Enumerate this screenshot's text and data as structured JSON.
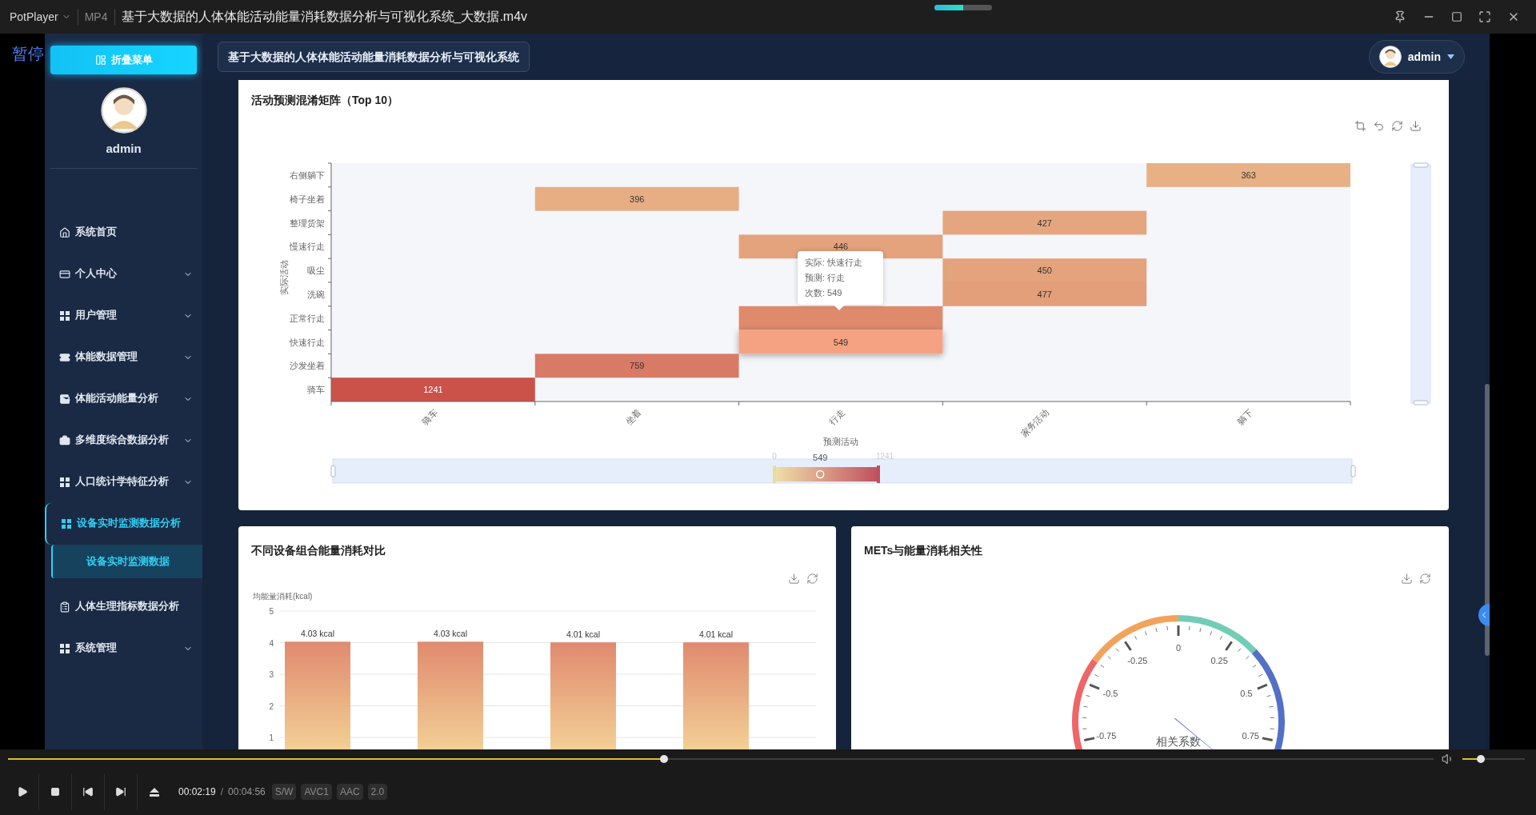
{
  "player": {
    "app_name": "PotPlayer",
    "format": "MP4",
    "file_title": "基于大数据的人体体能活动能量消耗数据分析与可视化系统_大数据.m4v",
    "osd": "暂停",
    "top_indicator": {
      "level": 0.5
    },
    "seek": {
      "level": 0.46
    },
    "volume": {
      "level": 0.3
    },
    "time_current": "00:02:19",
    "time_separator": "/",
    "time_total": "00:04:56",
    "tags": [
      "S/W",
      "AVC1",
      "AAC",
      "2.0"
    ]
  },
  "sidebar": {
    "collapse_button": "折叠菜单",
    "username": "admin",
    "items": [
      {
        "label": "系统首页",
        "kind": "link",
        "selected": false
      },
      {
        "label": "个人中心",
        "kind": "submenu",
        "selected": false,
        "expanded": false
      },
      {
        "label": "用户管理",
        "kind": "submenu",
        "selected": false,
        "expanded": false
      },
      {
        "label": "体能数据管理",
        "kind": "submenu",
        "selected": false,
        "expanded": false
      },
      {
        "label": "体能活动能量分析",
        "kind": "submenu",
        "selected": false,
        "expanded": false
      },
      {
        "label": "多维度综合数据分析",
        "kind": "submenu",
        "selected": false,
        "expanded": false
      },
      {
        "label": "人口统计学特征分析",
        "kind": "submenu",
        "selected": false,
        "expanded": false
      },
      {
        "label": "设备实时监测数据分析",
        "kind": "submenu",
        "selected": true,
        "expanded": true,
        "children": [
          {
            "label": "设备实时监测数据",
            "selected": true
          }
        ]
      },
      {
        "label": "人体生理指标数据分析",
        "kind": "link",
        "selected": false
      },
      {
        "label": "系统管理",
        "kind": "submenu",
        "selected": false,
        "expanded": false
      }
    ]
  },
  "header": {
    "title": "基于大数据的人体体能活动能量消耗数据分析与可视化系统",
    "user": "admin"
  },
  "confusion_matrix": {
    "title": "活动预测混淆矩阵（Top 10）",
    "x_axis_name": "预测活动",
    "y_axis_name": "实际活动",
    "x_categories": [
      "骑车",
      "坐着",
      "行走",
      "家务活动",
      "躺下"
    ],
    "rows": [
      {
        "label": "右侧躺下",
        "cells": [
          null,
          null,
          null,
          null,
          {
            "label": "363",
            "color": "#e8b085",
            "highlighted": false
          }
        ]
      },
      {
        "label": "椅子坐着",
        "cells": [
          null,
          {
            "label": "396",
            "color": "#e7ad83",
            "highlighted": false
          },
          null,
          null,
          null
        ]
      },
      {
        "label": "整理货架",
        "cells": [
          null,
          null,
          null,
          {
            "label": "427",
            "color": "#e5a67f",
            "highlighted": false
          },
          null
        ]
      },
      {
        "label": "慢速行走",
        "cells": [
          null,
          null,
          {
            "label": "446",
            "color": "#e4a37d",
            "highlighted": false
          },
          null,
          null
        ]
      },
      {
        "label": "吸尘",
        "cells": [
          null,
          null,
          null,
          {
            "label": "450",
            "color": "#e4a27d",
            "highlighted": false
          },
          null
        ]
      },
      {
        "label": "洗碗",
        "cells": [
          null,
          null,
          null,
          {
            "label": "477",
            "color": "#e39e7a",
            "highlighted": false
          },
          null
        ]
      },
      {
        "label": "正常行走",
        "cells": [
          null,
          null,
          {
            "color": "#df8a6c",
            "highlighted": false
          },
          null,
          null
        ]
      },
      {
        "label": "快速行走",
        "cells": [
          null,
          null,
          {
            "label": "549",
            "color": "#f5a282",
            "highlighted": true
          },
          null,
          null
        ]
      },
      {
        "label": "沙发坐着",
        "cells": [
          null,
          {
            "label": "759",
            "color": "#d97a66",
            "highlighted": false
          },
          null,
          null,
          null
        ]
      },
      {
        "label": "骑车",
        "cells": [
          {
            "label": "1241",
            "color": "#cb5249",
            "highlighted": false
          },
          null,
          null,
          null,
          null
        ]
      }
    ],
    "x_zoom": {
      "level": 1
    },
    "y_zoom": {
      "level": 1
    },
    "tooltip": [
      "实际: 快速行走",
      "预测: 行走",
      "次数: 549"
    ],
    "visual_map": {
      "min_label": "0",
      "max_label": "1241",
      "value_label": "549",
      "level": 0.44
    }
  },
  "device_energy": {
    "title": "不同设备组合能量消耗对比",
    "chart_data": {
      "type": "bar",
      "ylabel": "均能量消耗(kcal)",
      "values": [
        4.03,
        4.03,
        4.01,
        4.01
      ],
      "yticks": [
        1,
        2,
        3,
        4,
        5
      ],
      "ylim": [
        0,
        5
      ],
      "grid": true,
      "data_labels": true,
      "value_labels": [
        "4.03 kcal",
        "4.03 kcal",
        "4.01 kcal",
        "4.01 kcal"
      ]
    }
  },
  "mets_correlation": {
    "title": "METs与能量消耗相关性",
    "gauge": {
      "name": "相关系数",
      "scale_labels": [
        "-0.75",
        "-0.5",
        "-0.25",
        "0",
        "0.25",
        "0.5",
        "0.75"
      ]
    }
  }
}
